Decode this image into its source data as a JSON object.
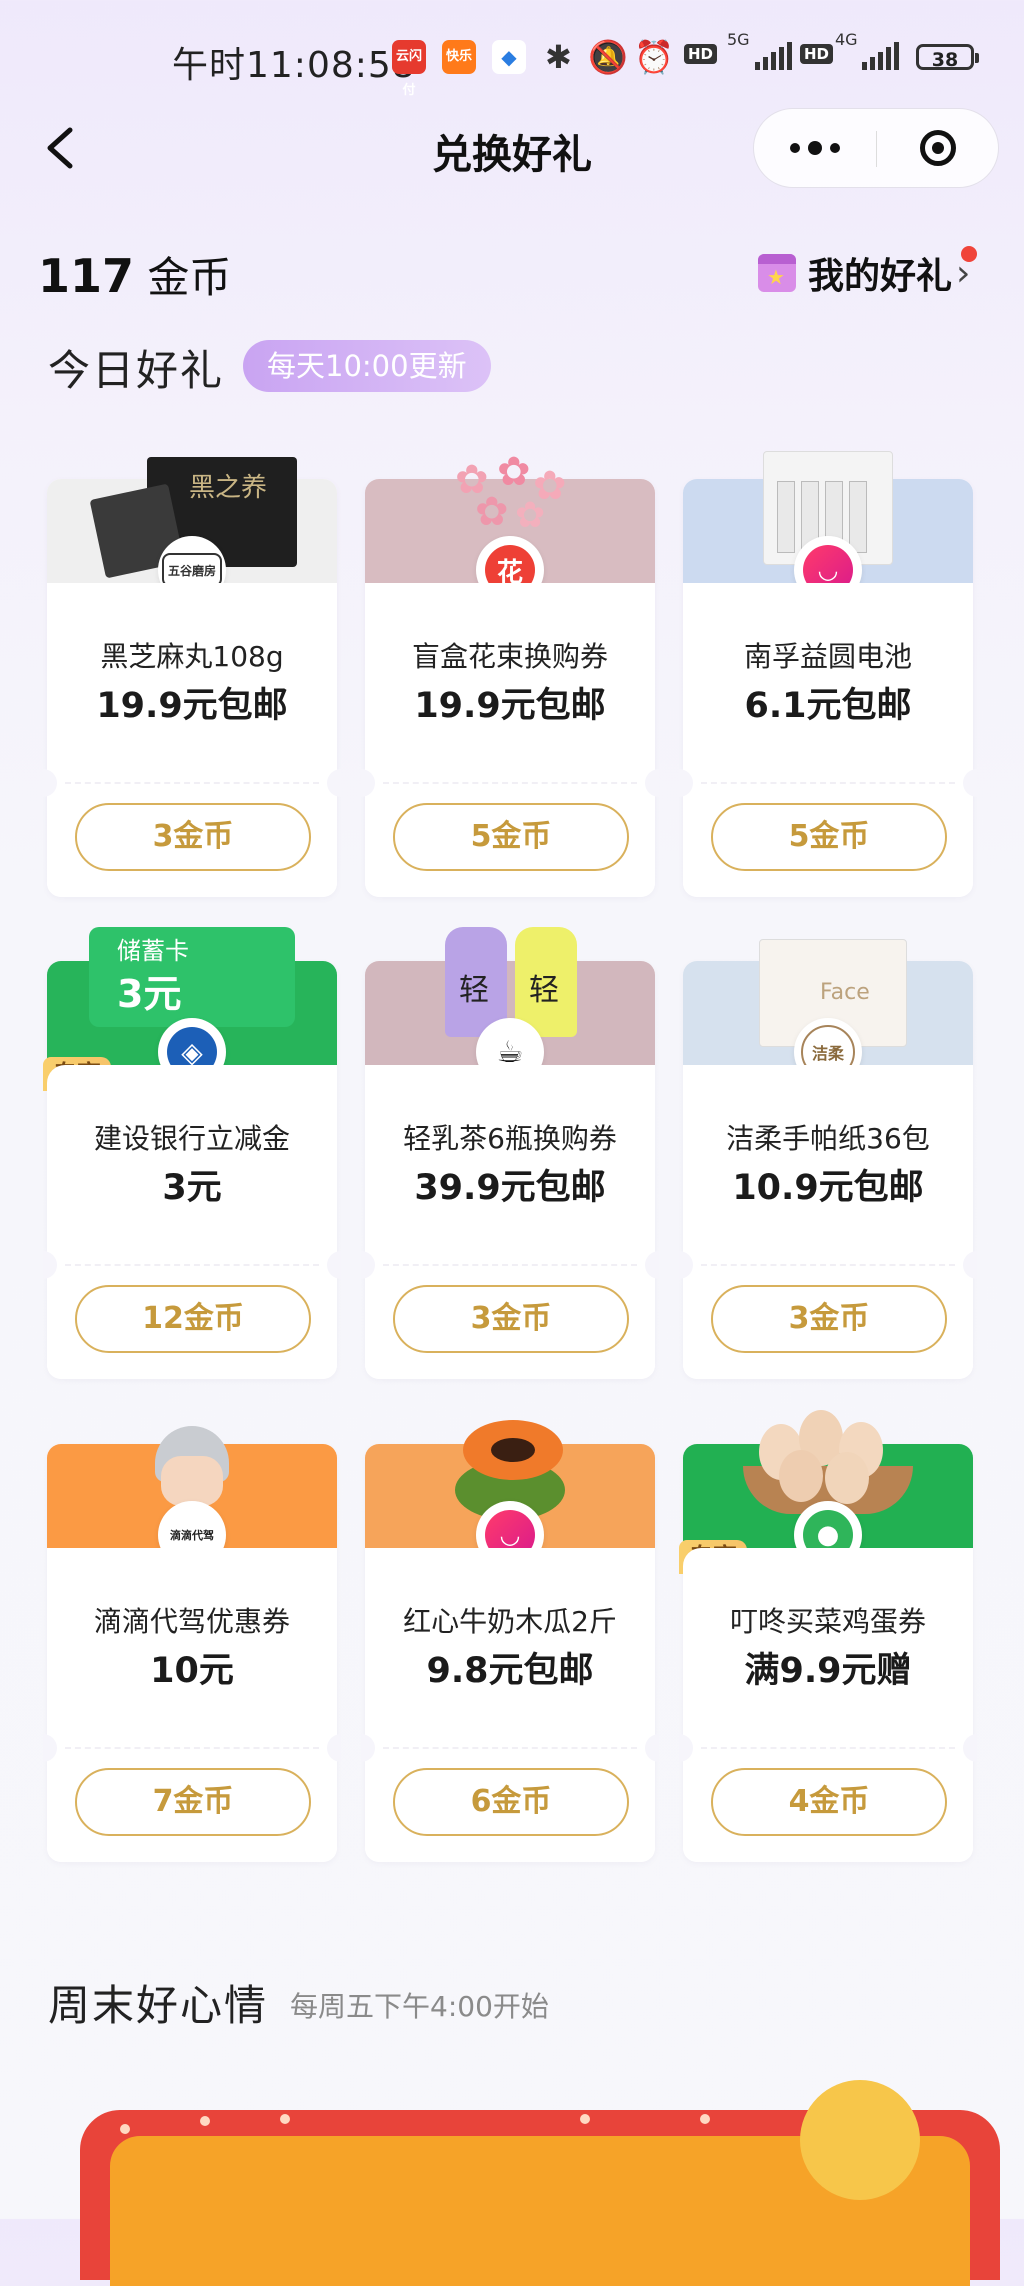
{
  "status_bar": {
    "time": "午时11:08:58",
    "net1": "5G",
    "net2": "4G",
    "hd": "HD",
    "battery": "38",
    "app_icons": [
      "云闪付",
      "快乐",
      "◆"
    ]
  },
  "nav": {
    "title": "兑换好礼"
  },
  "header": {
    "coins_value": "117",
    "coins_unit": "金币",
    "my_gifts": "我的好礼"
  },
  "today": {
    "title": "今日好礼",
    "badge": "每天10:00更新",
    "items": [
      {
        "name": "黑芝麻丸108g",
        "price": "19.9元包邮",
        "cost": "3金币",
        "exclusive": ""
      },
      {
        "name": "盲盒花束换购券",
        "price": "19.9元包邮",
        "cost": "5金币",
        "exclusive": ""
      },
      {
        "name": "南孚益圆电池",
        "price": "6.1元包邮",
        "cost": "5金币",
        "exclusive": ""
      },
      {
        "name": "建设银行立减金",
        "price": "3元",
        "cost": "12金币",
        "exclusive": "专享"
      },
      {
        "name": "轻乳茶6瓶换购券",
        "price": "39.9元包邮",
        "cost": "3金币",
        "exclusive": ""
      },
      {
        "name": "洁柔手帕纸36包",
        "price": "10.9元包邮",
        "cost": "3金币",
        "exclusive": ""
      },
      {
        "name": "滴滴代驾优惠券",
        "price": "10元",
        "cost": "7金币",
        "exclusive": ""
      },
      {
        "name": "红心牛奶木瓜2斤",
        "price": "9.8元包邮",
        "cost": "6金币",
        "exclusive": ""
      },
      {
        "name": "叮咚买菜鸡蛋券",
        "price": "满9.9元赠",
        "cost": "4金币",
        "exclusive": "专享"
      }
    ],
    "images": {
      "sesame_brand": "黑之养",
      "sesame_logo": "五谷磨房",
      "flower_logo": "花",
      "bank_card_title": "储蓄卡",
      "bank_card_value": "3元",
      "tea_label": "轻",
      "tissue_label": "Face",
      "tissue_logo": "洁柔",
      "didi_logo": "滴滴代驾"
    }
  },
  "weekend": {
    "title": "周末好心情",
    "subtitle": "每周五下午4:00开始"
  },
  "colors": {
    "gold_border": "#d9b15c",
    "gold_text": "#c69a3c",
    "badge_purple": "#c9a4f2",
    "card_top_grey": "#efefef",
    "card_top_pink": "#d8bcc1",
    "card_top_blue": "#ccdaf0",
    "card_top_green": "#27b45a",
    "card_top_mauve": "#d2b7bd",
    "card_top_lightblue": "#d6e1ee",
    "card_top_orange": "#fb9a44",
    "card_top_orange2": "#f6a45a",
    "card_top_green2": "#22b052"
  }
}
